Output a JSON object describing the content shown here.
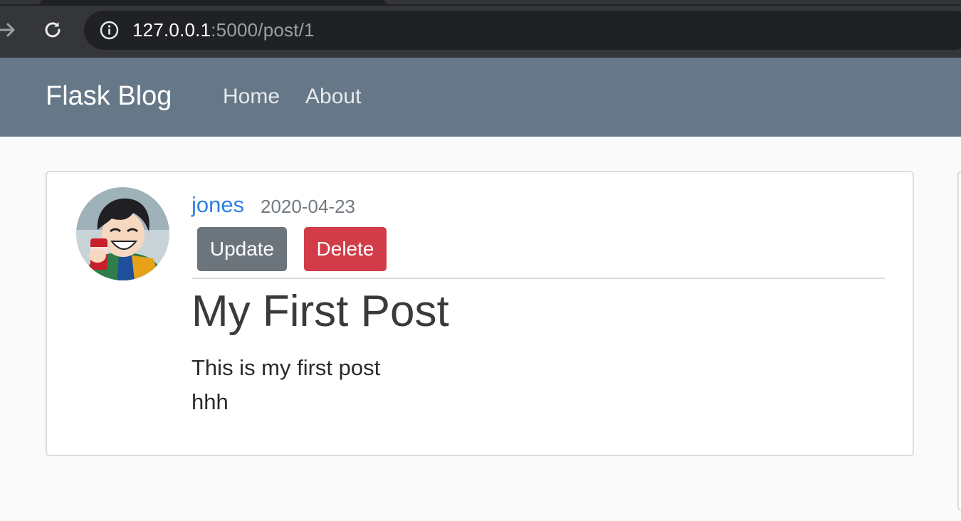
{
  "browser": {
    "url_host": "127.0.0.1",
    "url_path": ":5000/post/1",
    "icons": [
      "forward-icon",
      "reload-icon",
      "info-icon"
    ]
  },
  "navbar": {
    "brand": "Flask Blog",
    "links": [
      "Home",
      "About"
    ]
  },
  "post": {
    "author": "jones",
    "date": "2020-04-23",
    "update_label": "Update",
    "delete_label": "Delete",
    "title": "My First Post",
    "content_lines": [
      "This is my first post",
      "hhh"
    ]
  },
  "colors": {
    "navbar": "#667888",
    "author_link": "#2f7fe0",
    "update_button": "#6c747c",
    "delete_button": "#d13c48"
  }
}
